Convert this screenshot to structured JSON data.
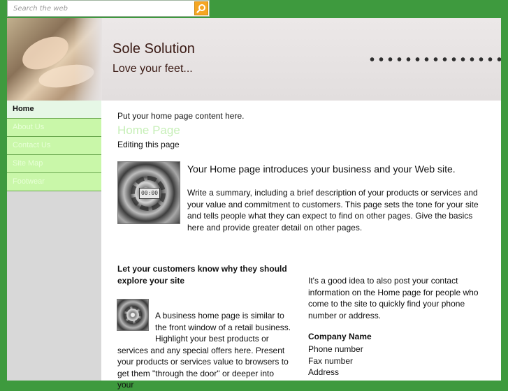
{
  "search": {
    "placeholder": "Search the web"
  },
  "header": {
    "site_title": "Sole Solution",
    "tagline": "Love your feet..."
  },
  "nav": {
    "items": [
      {
        "label": "Home",
        "active": true
      },
      {
        "label": "About Us",
        "active": false
      },
      {
        "label": "Contact Us",
        "active": false
      },
      {
        "label": "Site Map",
        "active": false
      },
      {
        "label": "Footwear",
        "active": false
      }
    ]
  },
  "content": {
    "intro": "Put your home page content here.",
    "heading": "Home Page",
    "editing": "Editing this page",
    "lead": "Your Home page introduces your business and your Web site.",
    "summary": "Write a summary, including a brief description of your products or services and your value and commitment to customers. This page sets the tone for your site and tells people what they can expect to find on other pages. Give the basics here and provide greater detail on other pages.",
    "why_heading": "Let your customers know why they should explore your site",
    "business_text": "A business home page is similar to the front window of a retail business. Highlight your best products or services and any special offers here. Present your products or services value to browsers to get them \"through the door\" or deeper into your",
    "contact_info": "It's a good idea to also post your contact information on the Home page for people who come to the site to quickly find your phone number or address.",
    "company_name": "Company Name",
    "phone": "Phone number",
    "fax": "Fax number",
    "address": "Address",
    "gear_display": "00:00"
  },
  "colors": {
    "page_background": "#3e9a3e",
    "nav_active": "#e6f7e6",
    "nav_item": "#c9f7a9",
    "search_button": "#f5a623",
    "heading_green": "#c7efb8"
  },
  "icons": {
    "search_button": "search-icon"
  }
}
